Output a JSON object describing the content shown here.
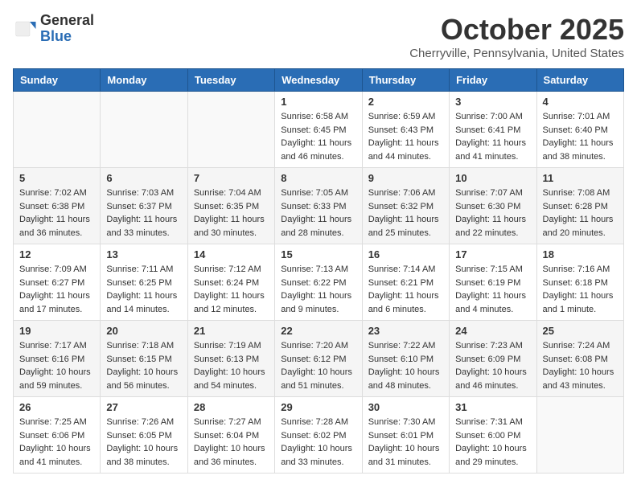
{
  "header": {
    "logo_general": "General",
    "logo_blue": "Blue",
    "month_title": "October 2025",
    "location": "Cherryville, Pennsylvania, United States"
  },
  "days_of_week": [
    "Sunday",
    "Monday",
    "Tuesday",
    "Wednesday",
    "Thursday",
    "Friday",
    "Saturday"
  ],
  "weeks": [
    [
      {
        "day": "",
        "info": ""
      },
      {
        "day": "",
        "info": ""
      },
      {
        "day": "",
        "info": ""
      },
      {
        "day": "1",
        "info": "Sunrise: 6:58 AM\nSunset: 6:45 PM\nDaylight: 11 hours\nand 46 minutes."
      },
      {
        "day": "2",
        "info": "Sunrise: 6:59 AM\nSunset: 6:43 PM\nDaylight: 11 hours\nand 44 minutes."
      },
      {
        "day": "3",
        "info": "Sunrise: 7:00 AM\nSunset: 6:41 PM\nDaylight: 11 hours\nand 41 minutes."
      },
      {
        "day": "4",
        "info": "Sunrise: 7:01 AM\nSunset: 6:40 PM\nDaylight: 11 hours\nand 38 minutes."
      }
    ],
    [
      {
        "day": "5",
        "info": "Sunrise: 7:02 AM\nSunset: 6:38 PM\nDaylight: 11 hours\nand 36 minutes."
      },
      {
        "day": "6",
        "info": "Sunrise: 7:03 AM\nSunset: 6:37 PM\nDaylight: 11 hours\nand 33 minutes."
      },
      {
        "day": "7",
        "info": "Sunrise: 7:04 AM\nSunset: 6:35 PM\nDaylight: 11 hours\nand 30 minutes."
      },
      {
        "day": "8",
        "info": "Sunrise: 7:05 AM\nSunset: 6:33 PM\nDaylight: 11 hours\nand 28 minutes."
      },
      {
        "day": "9",
        "info": "Sunrise: 7:06 AM\nSunset: 6:32 PM\nDaylight: 11 hours\nand 25 minutes."
      },
      {
        "day": "10",
        "info": "Sunrise: 7:07 AM\nSunset: 6:30 PM\nDaylight: 11 hours\nand 22 minutes."
      },
      {
        "day": "11",
        "info": "Sunrise: 7:08 AM\nSunset: 6:28 PM\nDaylight: 11 hours\nand 20 minutes."
      }
    ],
    [
      {
        "day": "12",
        "info": "Sunrise: 7:09 AM\nSunset: 6:27 PM\nDaylight: 11 hours\nand 17 minutes."
      },
      {
        "day": "13",
        "info": "Sunrise: 7:11 AM\nSunset: 6:25 PM\nDaylight: 11 hours\nand 14 minutes."
      },
      {
        "day": "14",
        "info": "Sunrise: 7:12 AM\nSunset: 6:24 PM\nDaylight: 11 hours\nand 12 minutes."
      },
      {
        "day": "15",
        "info": "Sunrise: 7:13 AM\nSunset: 6:22 PM\nDaylight: 11 hours\nand 9 minutes."
      },
      {
        "day": "16",
        "info": "Sunrise: 7:14 AM\nSunset: 6:21 PM\nDaylight: 11 hours\nand 6 minutes."
      },
      {
        "day": "17",
        "info": "Sunrise: 7:15 AM\nSunset: 6:19 PM\nDaylight: 11 hours\nand 4 minutes."
      },
      {
        "day": "18",
        "info": "Sunrise: 7:16 AM\nSunset: 6:18 PM\nDaylight: 11 hours\nand 1 minute."
      }
    ],
    [
      {
        "day": "19",
        "info": "Sunrise: 7:17 AM\nSunset: 6:16 PM\nDaylight: 10 hours\nand 59 minutes."
      },
      {
        "day": "20",
        "info": "Sunrise: 7:18 AM\nSunset: 6:15 PM\nDaylight: 10 hours\nand 56 minutes."
      },
      {
        "day": "21",
        "info": "Sunrise: 7:19 AM\nSunset: 6:13 PM\nDaylight: 10 hours\nand 54 minutes."
      },
      {
        "day": "22",
        "info": "Sunrise: 7:20 AM\nSunset: 6:12 PM\nDaylight: 10 hours\nand 51 minutes."
      },
      {
        "day": "23",
        "info": "Sunrise: 7:22 AM\nSunset: 6:10 PM\nDaylight: 10 hours\nand 48 minutes."
      },
      {
        "day": "24",
        "info": "Sunrise: 7:23 AM\nSunset: 6:09 PM\nDaylight: 10 hours\nand 46 minutes."
      },
      {
        "day": "25",
        "info": "Sunrise: 7:24 AM\nSunset: 6:08 PM\nDaylight: 10 hours\nand 43 minutes."
      }
    ],
    [
      {
        "day": "26",
        "info": "Sunrise: 7:25 AM\nSunset: 6:06 PM\nDaylight: 10 hours\nand 41 minutes."
      },
      {
        "day": "27",
        "info": "Sunrise: 7:26 AM\nSunset: 6:05 PM\nDaylight: 10 hours\nand 38 minutes."
      },
      {
        "day": "28",
        "info": "Sunrise: 7:27 AM\nSunset: 6:04 PM\nDaylight: 10 hours\nand 36 minutes."
      },
      {
        "day": "29",
        "info": "Sunrise: 7:28 AM\nSunset: 6:02 PM\nDaylight: 10 hours\nand 33 minutes."
      },
      {
        "day": "30",
        "info": "Sunrise: 7:30 AM\nSunset: 6:01 PM\nDaylight: 10 hours\nand 31 minutes."
      },
      {
        "day": "31",
        "info": "Sunrise: 7:31 AM\nSunset: 6:00 PM\nDaylight: 10 hours\nand 29 minutes."
      },
      {
        "day": "",
        "info": ""
      }
    ]
  ]
}
